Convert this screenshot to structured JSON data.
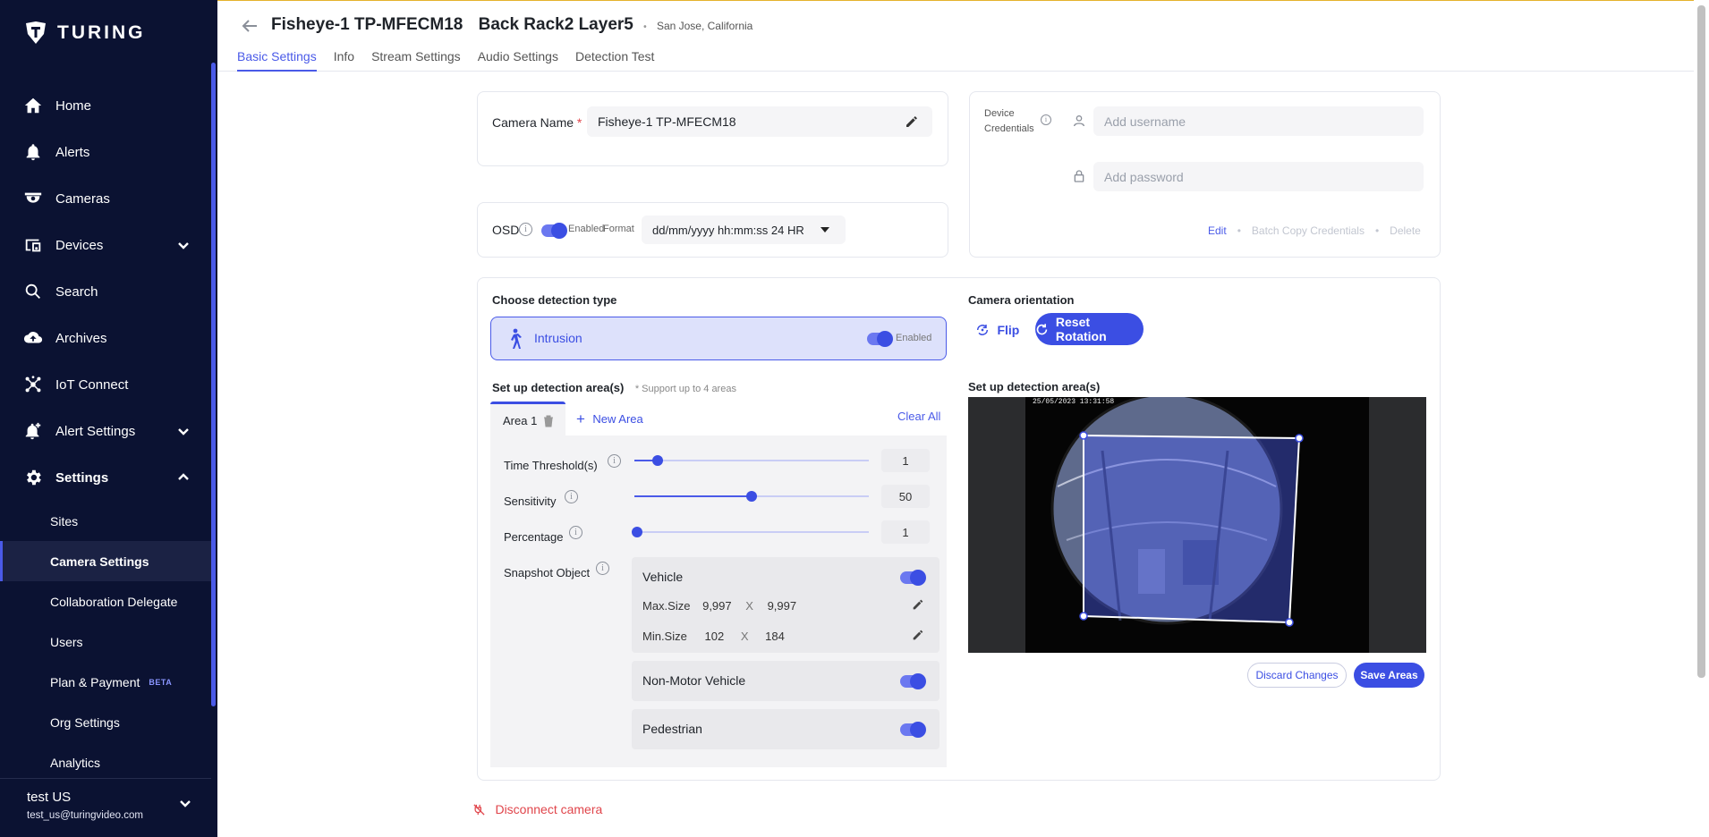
{
  "brand": {
    "name": "TURING"
  },
  "sidebar": {
    "items": [
      {
        "label": "Home",
        "icon": "home-icon"
      },
      {
        "label": "Alerts",
        "icon": "bell-icon"
      },
      {
        "label": "Cameras",
        "icon": "camera-icon"
      },
      {
        "label": "Devices",
        "icon": "devices-icon",
        "expandable": true
      },
      {
        "label": "Search",
        "icon": "search-icon"
      },
      {
        "label": "Archives",
        "icon": "cloud-upload-icon"
      },
      {
        "label": "IoT Connect",
        "icon": "hub-icon"
      },
      {
        "label": "Alert Settings",
        "icon": "alert-settings-icon",
        "expandable": true
      },
      {
        "label": "Settings",
        "icon": "gear-icon",
        "expanded": true
      }
    ],
    "sub_items": [
      {
        "label": "Sites"
      },
      {
        "label": "Camera Settings",
        "active": true
      },
      {
        "label": "Collaboration Delegate"
      },
      {
        "label": "Users"
      },
      {
        "label": "Plan & Payment",
        "badge": "BETA"
      },
      {
        "label": "Org Settings"
      },
      {
        "label": "Analytics"
      }
    ],
    "user": {
      "name": "test US",
      "email": "test_us@turingvideo.com"
    }
  },
  "header": {
    "camera_name": "Fisheye-1 TP-MFECM18",
    "location_name": "Back Rack2 Layer5",
    "city": "San Jose, California",
    "separator": "•",
    "tabs": [
      "Basic Settings",
      "Info",
      "Stream Settings",
      "Audio Settings",
      "Detection Test"
    ],
    "active_tab": "Basic Settings"
  },
  "camera_name_card": {
    "label": "Camera Name",
    "required_mark": "*",
    "value": "Fisheye-1 TP-MFECM18"
  },
  "credentials": {
    "label_line1": "Device",
    "label_line2": "Credentials",
    "username_placeholder": "Add username",
    "password_placeholder": "Add password",
    "edit": "Edit",
    "batch_copy": "Batch Copy Credentials",
    "delete": "Delete",
    "dot": "•"
  },
  "osd": {
    "label": "OSD",
    "toggle_label": "Enabled",
    "format_label": "Format",
    "format_value": "dd/mm/yyyy hh:mm:ss 24 HR",
    "enabled": true
  },
  "detection": {
    "choose_label": "Choose detection type",
    "type": "Intrusion",
    "type_status": "Enabled",
    "setup_label": "Set up detection area(s)",
    "support_note": "* Support up to 4 areas",
    "area_tab": "Area 1",
    "new_area": "New Area",
    "clear_all": "Clear All",
    "time_threshold": {
      "label": "Time Threshold(s)",
      "value": "1",
      "fraction": 0.1
    },
    "sensitivity": {
      "label": "Sensitivity",
      "value": "50",
      "fraction": 0.5
    },
    "percentage": {
      "label": "Percentage",
      "value": "1",
      "fraction": 0.01
    },
    "snapshot_label": "Snapshot Object",
    "objects": [
      {
        "name": "Vehicle",
        "enabled": true,
        "max_label": "Max.Size",
        "max_w": "9,997",
        "max_h": "9,997",
        "min_label": "Min.Size",
        "min_w": "102",
        "min_h": "184",
        "x": "X"
      },
      {
        "name": "Non-Motor Vehicle",
        "enabled": true
      },
      {
        "name": "Pedestrian",
        "enabled": true
      }
    ]
  },
  "orientation": {
    "label": "Camera orientation",
    "flip": "Flip",
    "reset": "Reset Rotation",
    "area_label": "Set up detection area(s)",
    "timestamp": "25/05/2023 13:31:58",
    "discard": "Discard Changes",
    "save": "Save Areas"
  },
  "disconnect": "Disconnect camera",
  "colors": {
    "accent": "#3b4ee3",
    "sidebar": "#0b1232",
    "danger": "#e0454b"
  }
}
